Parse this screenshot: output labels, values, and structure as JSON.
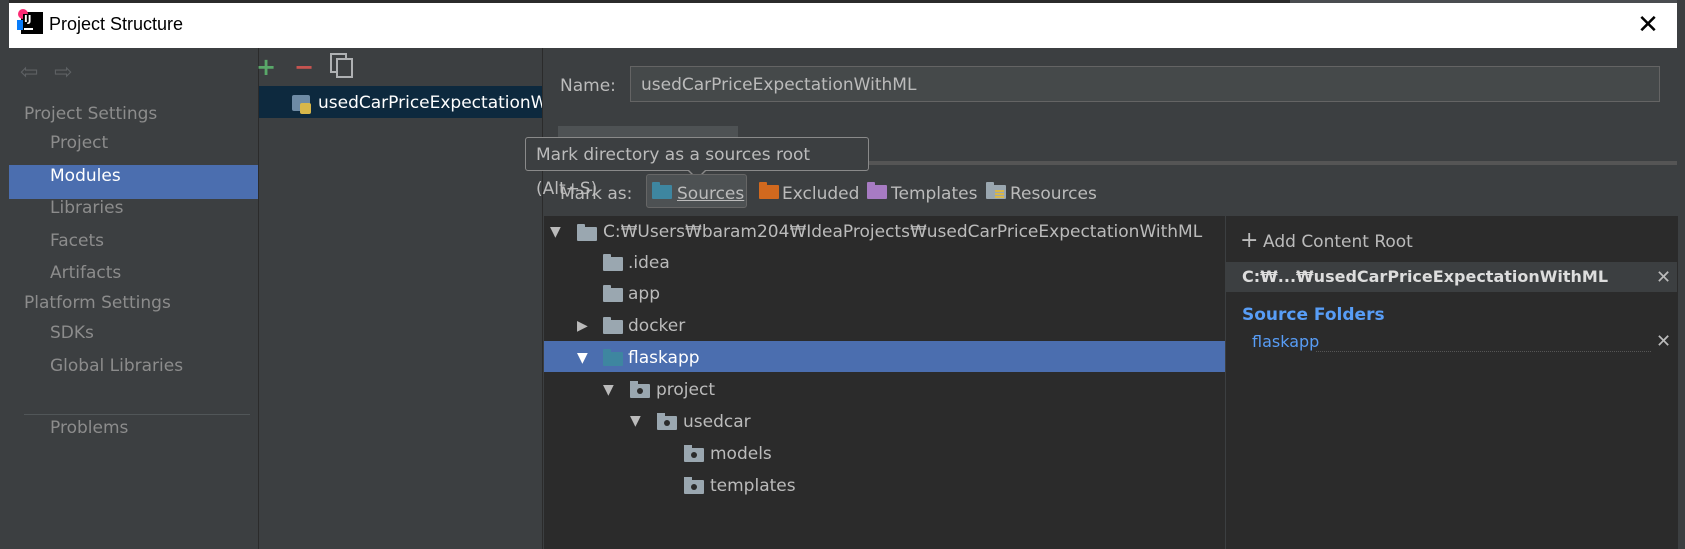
{
  "window": {
    "title": "Project Structure",
    "close_label": "✕"
  },
  "nav": {
    "back_icon": "arrow-left-icon",
    "forward_icon": "arrow-right-icon",
    "project_settings_header": "Project Settings",
    "project_settings": [
      "Project",
      "Modules",
      "Libraries",
      "Facets",
      "Artifacts"
    ],
    "platform_settings_header": "Platform Settings",
    "platform_settings": [
      "SDKs",
      "Global Libraries"
    ],
    "problems": "Problems",
    "selected": "Modules"
  },
  "modules": {
    "toolbar": {
      "add": "+",
      "remove": "−",
      "copy_icon": "copy-icon"
    },
    "items": [
      "usedCarPriceExpectationWithML"
    ]
  },
  "main": {
    "name_label": "Name:",
    "name_value": "usedCarPriceExpectationWithML",
    "tooltip": "Mark directory as a sources root (Alt+S)",
    "mark_as_label": "Mark as:",
    "mark_options": [
      "Sources",
      "Excluded",
      "Templates",
      "Resources"
    ],
    "mark_colors": {
      "sources": "#3e86a0",
      "excluded": "#d2691e",
      "templates": "#a77bc3",
      "resources": "#9aa7b0"
    }
  },
  "tree": {
    "nodes": [
      {
        "label": "C:₩Users₩baram204₩IdeaProjects₩usedCarPriceExpectationWithML",
        "toggle": "▼"
      },
      {
        "label": ".idea",
        "toggle": ""
      },
      {
        "label": "app",
        "toggle": ""
      },
      {
        "label": "docker",
        "toggle": "▶"
      },
      {
        "label": "flaskapp",
        "toggle": "▼"
      },
      {
        "label": "project",
        "toggle": "▼"
      },
      {
        "label": "usedcar",
        "toggle": "▼"
      },
      {
        "label": "models",
        "toggle": ""
      },
      {
        "label": "templates",
        "toggle": ""
      }
    ],
    "selected": "flaskapp"
  },
  "content_root": {
    "add_label": "Add Content Root",
    "root_path": "C:₩...₩usedCarPriceExpectationWithML",
    "source_folders_header": "Source Folders",
    "source_folders": [
      "flaskapp"
    ],
    "remove_label": "✕"
  }
}
